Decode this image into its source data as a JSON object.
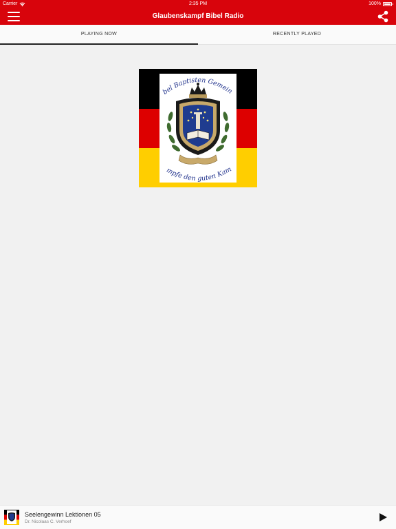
{
  "status_bar": {
    "carrier": "Carrier",
    "time": "2:35 PM",
    "battery": "100%"
  },
  "nav": {
    "title": "Glaubenskampf Bibel Radio",
    "menu_icon": "hamburger-menu-icon",
    "share_icon": "share-icon"
  },
  "tabs": [
    {
      "label": "PLAYING NOW",
      "active": true
    },
    {
      "label": "RECENTLY PLAYED",
      "active": false
    }
  ],
  "artwork": {
    "top_text": "Bibel Baptisten Gemeinde",
    "bottom_text": "Kämpfe den guten Kampf",
    "flag_colors": [
      "#000000",
      "#dd0000",
      "#ffce00"
    ]
  },
  "now_playing": {
    "title": "Seelengewinn Lektionen 05",
    "artist": "Dr. Nicolaas C. Verhoef",
    "play_icon": "play-icon"
  },
  "colors": {
    "accent": "#d8040c",
    "background": "#f1f1f1"
  }
}
